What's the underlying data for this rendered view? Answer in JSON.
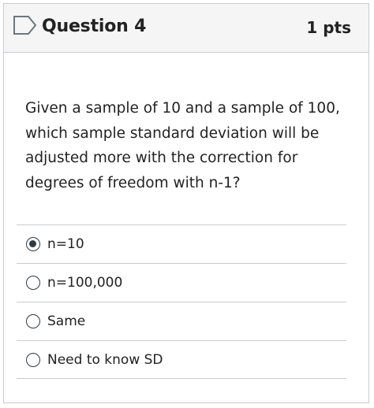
{
  "question": {
    "title": "Question 4",
    "points": "1 pts",
    "text": "Given a sample of 10 and a sample of 100, which sample standard deviation will be adjusted more with the correction for degrees of freedom with n-1?",
    "flag_icon": "flag-outline-icon"
  },
  "answers": [
    {
      "label": "n=10",
      "selected": true
    },
    {
      "label": "n=100,000",
      "selected": false
    },
    {
      "label": "Same",
      "selected": false
    },
    {
      "label": "Need to know SD",
      "selected": false
    }
  ],
  "colors": {
    "header_bg": "#f5f5f5",
    "border": "#c7cdd1",
    "text": "#222222",
    "radio": "#2d3b45"
  }
}
